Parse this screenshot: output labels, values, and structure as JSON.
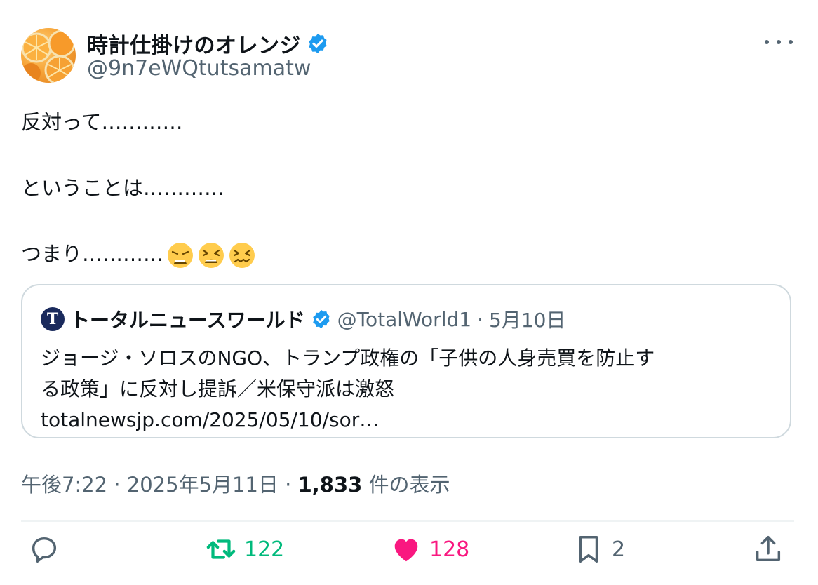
{
  "author": {
    "display_name": "時計仕掛けのオレンジ",
    "handle": "@9n7eWQtutsamatw",
    "avatar_icon": "orange-slices-avatar",
    "verified": true
  },
  "post": {
    "lines": [
      "反対って…………",
      "ということは…………",
      "つまり…………"
    ],
    "emojis": [
      "weary-face",
      "tired-face",
      "confounded-face"
    ]
  },
  "quote": {
    "logo_letter": "T",
    "name": "トータルニュースワールド",
    "handle": "@TotalWorld1",
    "separator": "·",
    "date": "5月10日",
    "text_line1": "ジョージ・ソロスのNGO、トランプ政権の「子供の人身売買を防止す",
    "text_line2": "る政策」に反対し提訴／米保守派は激怒",
    "link": "totalnewsjp.com/2025/05/10/sor…"
  },
  "meta": {
    "time": "午後7:22",
    "date": "2025年5月11日",
    "separator": "·",
    "views_count": "1,833",
    "views_label": "件の表示"
  },
  "actions": {
    "reply_count": "",
    "retweet_count": "122",
    "like_count": "128",
    "bookmark_count": "2"
  },
  "colors": {
    "verified": "#1d9bf0",
    "retweet": "#00ba7c",
    "like": "#f91880",
    "secondary_text": "#536471"
  }
}
